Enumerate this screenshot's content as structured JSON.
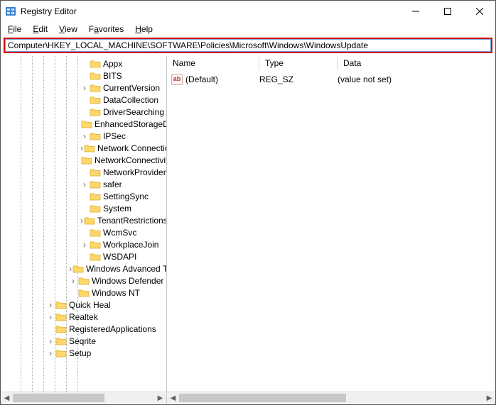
{
  "window": {
    "title": "Registry Editor"
  },
  "menu": {
    "file": "File",
    "edit": "Edit",
    "view": "View",
    "favorites": "Favorites",
    "help": "Help"
  },
  "address": {
    "value": "Computer\\HKEY_LOCAL_MACHINE\\SOFTWARE\\Policies\\Microsoft\\Windows\\WindowsUpdate"
  },
  "tree": [
    {
      "indent": 112,
      "expand": "none",
      "label": "Appx"
    },
    {
      "indent": 112,
      "expand": "none",
      "label": "BITS"
    },
    {
      "indent": 112,
      "expand": "closed",
      "label": "CurrentVersion"
    },
    {
      "indent": 112,
      "expand": "none",
      "label": "DataCollection"
    },
    {
      "indent": 112,
      "expand": "none",
      "label": "DriverSearching"
    },
    {
      "indent": 112,
      "expand": "none",
      "label": "EnhancedStorageDevices"
    },
    {
      "indent": 112,
      "expand": "closed",
      "label": "IPSec"
    },
    {
      "indent": 112,
      "expand": "closed",
      "label": "Network Connections"
    },
    {
      "indent": 112,
      "expand": "none",
      "label": "NetworkConnectivityStatusIndicator"
    },
    {
      "indent": 112,
      "expand": "none",
      "label": "NetworkProvider"
    },
    {
      "indent": 112,
      "expand": "closed",
      "label": "safer"
    },
    {
      "indent": 112,
      "expand": "none",
      "label": "SettingSync"
    },
    {
      "indent": 112,
      "expand": "none",
      "label": "System"
    },
    {
      "indent": 112,
      "expand": "closed",
      "label": "TenantRestrictions"
    },
    {
      "indent": 112,
      "expand": "none",
      "label": "WcmSvc"
    },
    {
      "indent": 112,
      "expand": "closed",
      "label": "WorkplaceJoin"
    },
    {
      "indent": 112,
      "expand": "none",
      "label": "WSDAPI"
    },
    {
      "indent": 96,
      "expand": "closed",
      "label": "Windows Advanced Threat Protection"
    },
    {
      "indent": 96,
      "expand": "closed",
      "label": "Windows Defender"
    },
    {
      "indent": 96,
      "expand": "none",
      "label": "Windows NT"
    },
    {
      "indent": 64,
      "expand": "closed",
      "label": "Quick Heal"
    },
    {
      "indent": 64,
      "expand": "closed",
      "label": "Realtek"
    },
    {
      "indent": 64,
      "expand": "none",
      "label": "RegisteredApplications"
    },
    {
      "indent": 64,
      "expand": "closed",
      "label": "Seqrite"
    },
    {
      "indent": 64,
      "expand": "closed",
      "label": "Setup"
    }
  ],
  "list": {
    "columns": {
      "name": "Name",
      "type": "Type",
      "data": "Data"
    },
    "col_widths": {
      "name": 130,
      "type": 110,
      "data": 200
    },
    "rows": [
      {
        "name": "(Default)",
        "type": "REG_SZ",
        "data": "(value not set)"
      }
    ]
  }
}
